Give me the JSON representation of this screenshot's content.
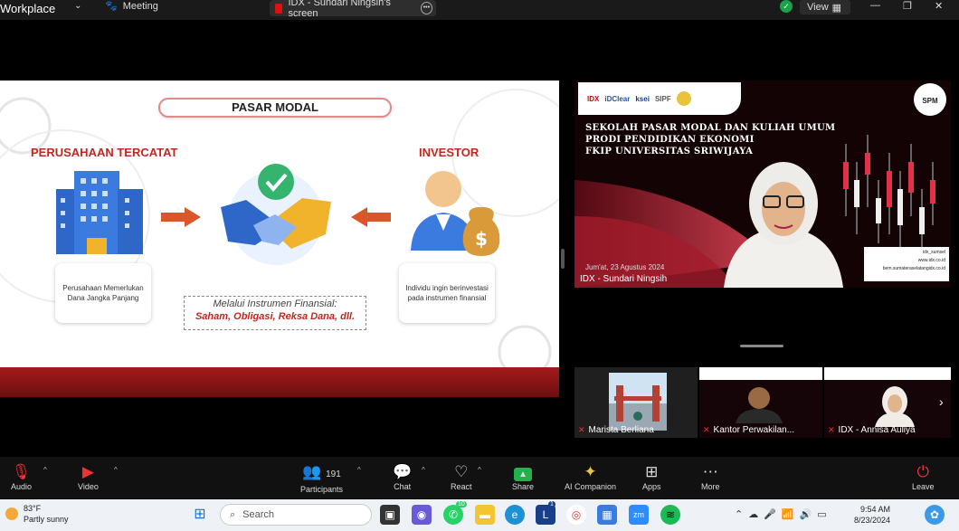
{
  "topbar": {
    "app_name": "Workplace",
    "meeting_label": "Meeting",
    "share_title": "IDX - Sundari Ningsih's screen",
    "view_label": "View"
  },
  "slide": {
    "title": "PASAR MODAL",
    "left_heading": "PERUSAHAAN TERCATAT",
    "right_heading": "INVESTOR",
    "left_card": "Perusahaan Memerlukan Dana Jangka Panjang",
    "right_card": "Individu ingin berinvestasi pada instrumen finansial",
    "instrument_line1": "Melalui Instrumen Finansial:",
    "instrument_line2": "Saham, Obligasi, Reksa Dana, dll."
  },
  "speaker": {
    "logos": [
      "IDX",
      "iDClear",
      "ksei",
      "SIPF"
    ],
    "badge": "SPM",
    "headline": [
      "SEKOLAH PASAR MODAL DAN KULIAH UMUM",
      "PRODI PENDIDIKAN EKONOMI",
      "FKIP UNIVERSITAS SRIWIJAYA"
    ],
    "date": "Jum'at, 23 Agustus 2024",
    "socials": [
      "idx_sumsel",
      "www.idx.co.id",
      "bem.sumateraselatangidx.co.id"
    ],
    "name": "IDX - Sundari Ningsih"
  },
  "participants_strip": [
    {
      "name": "Marista Berliana"
    },
    {
      "name": "Kantor Perwakilan..."
    },
    {
      "name": "IDX - Annisa Auliya"
    }
  ],
  "controls": {
    "audio": "Audio",
    "video": "Video",
    "participants": "Participants",
    "participant_count": "191",
    "chat": "Chat",
    "react": "React",
    "share": "Share",
    "ai": "AI Companion",
    "apps": "Apps",
    "more": "More",
    "leave": "Leave"
  },
  "taskbar": {
    "temperature": "83°F",
    "weather": "Partly sunny",
    "search_placeholder": "Search",
    "whatsapp_badge": "10",
    "app_badge": "1",
    "time": "9:54 AM",
    "date": "8/23/2024"
  },
  "colors": {
    "accent_red": "#c0281f",
    "share_green": "#22b14c",
    "zoom_blue": "#2d8cff"
  }
}
